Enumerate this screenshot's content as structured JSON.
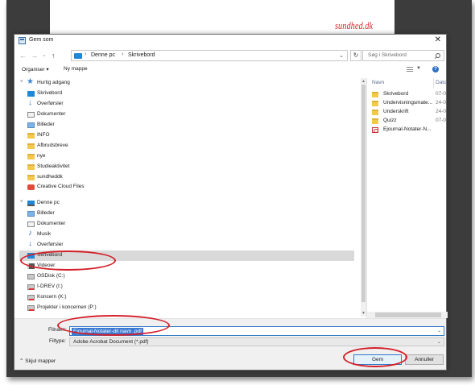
{
  "background": {
    "logo_text": "sundhed.dk"
  },
  "dialog": {
    "title": "Gem som",
    "close_glyph": "✕"
  },
  "address": {
    "back": "←",
    "forward": "→",
    "history": "⌄",
    "up": "↑",
    "crumbs": [
      "Denne pc",
      "Skrivebord"
    ],
    "separator": "›",
    "refresh": "↻",
    "search_placeholder": "Søg i Skrivebord"
  },
  "toolbar": {
    "organize": "Organiser ▾",
    "new_folder": "Ny mappe",
    "help": "?"
  },
  "nav": {
    "quick_access": "Hurtig adgang",
    "quick_items": [
      {
        "label": "Skrivebord",
        "pinned": true
      },
      {
        "label": "Overførsler",
        "pinned": true
      },
      {
        "label": "Dokumenter",
        "pinned": true
      },
      {
        "label": "Billeder",
        "pinned": true
      },
      {
        "label": "INFO",
        "pinned": true
      },
      {
        "label": "Afbrudsbreve",
        "pinned": false
      },
      {
        "label": "nye",
        "pinned": false
      },
      {
        "label": "Studieaktivitet",
        "pinned": false
      },
      {
        "label": "sundheddk",
        "pinned": false
      }
    ],
    "creative_cloud": "Creative Cloud Files",
    "this_pc": "Denne pc",
    "pc_items": [
      {
        "label": "Billeder"
      },
      {
        "label": "Dokumenter"
      },
      {
        "label": "Musik"
      },
      {
        "label": "Overførsler"
      },
      {
        "label": "Skrivebord",
        "selected": true
      },
      {
        "label": "Videoer"
      },
      {
        "label": "OSDisk (C:)"
      },
      {
        "label": "I-DREV (I:)"
      },
      {
        "label": "Koncern (K:)"
      },
      {
        "label": "Projekter i koncernen (P:)"
      }
    ]
  },
  "content": {
    "col_name": "Navn",
    "col_date": "Dato",
    "files": [
      {
        "name": "Skrivebord",
        "date": "07-0",
        "type": "folder"
      },
      {
        "name": "Undervisningsmate...",
        "date": "24-0",
        "type": "folder"
      },
      {
        "name": "Underskrift",
        "date": "24-0",
        "type": "folder"
      },
      {
        "name": "Quizz",
        "date": "07-0",
        "type": "folder"
      },
      {
        "name": "Ejournal-Notater-N...",
        "date": "",
        "type": "pdf"
      }
    ]
  },
  "form": {
    "filename_label": "Filnavn:",
    "filename_value": "Ejournal-Notater-dit navn .pdf",
    "filetype_label": "Filtype:",
    "filetype_value": "Adobe Acrobat Document (*.pdf)",
    "hide_folders": "Skjul mapper",
    "hide_glyph": "⌃",
    "save": "Gem",
    "cancel": "Annuller"
  },
  "colors": {
    "annotation": "#d3202a",
    "selection": "#3b79d2",
    "logo": "#d9262d"
  }
}
